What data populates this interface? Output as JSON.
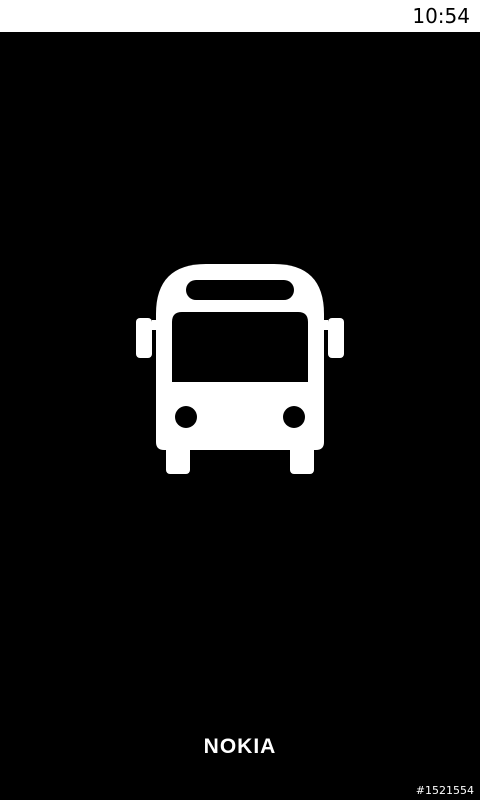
{
  "status_bar": {
    "time": "10:54"
  },
  "splash": {
    "icon": "bus-icon",
    "icon_color": "#ffffff",
    "background_color": "#000000"
  },
  "branding": {
    "logo_text": "NOKIA"
  },
  "footer": {
    "build_id": "#1521554"
  }
}
